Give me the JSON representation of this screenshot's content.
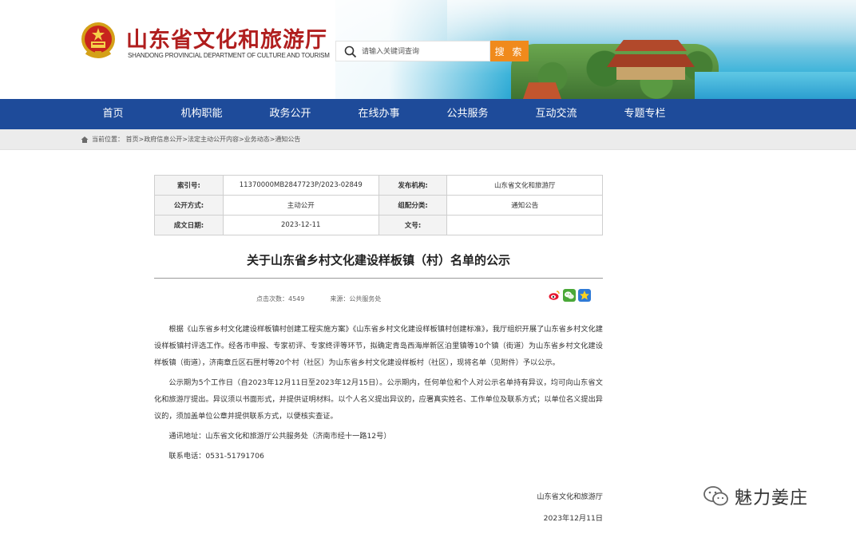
{
  "header": {
    "site_name": "山东省文化和旅游厅",
    "site_name_en": "SHANDONG PROVINCIAL DEPARTMENT OF CULTURE AND TOURISM",
    "search_placeholder": "请输入关键词查询",
    "search_button": "搜 索"
  },
  "nav": {
    "items": [
      "首页",
      "机构职能",
      "政务公开",
      "在线办事",
      "公共服务",
      "互动交流",
      "专题专栏"
    ]
  },
  "breadcrumb": {
    "label": "当前位置：",
    "path": "首页>政府信息公开>法定主动公开内容>业务动态>通知公告"
  },
  "meta": {
    "index_key": "索引号:",
    "index_value": "11370000MB2847723P/2023-02849",
    "publisher_key": "发布机构:",
    "publisher_value": "山东省文化和旅游厅",
    "mode_key": "公开方式:",
    "mode_value": "主动公开",
    "category_key": "组配分类:",
    "category_value": "通知公告",
    "date_key": "成文日期:",
    "date_value": "2023-12-11",
    "doc_no_key": "文号:",
    "doc_no_value": ""
  },
  "article": {
    "title": "关于山东省乡村文化建设样板镇（村）名单的公示",
    "views_label": "点击次数：",
    "views_value": "4549",
    "source_label": "来源：",
    "source_value": "公共服务处",
    "p1": "根据《山东省乡村文化建设样板镇村创建工程实施方案》《山东省乡村文化建设样板镇村创建标准》，我厅组织开展了山东省乡村文化建设样板镇村评选工作。经各市申报、专家初评、专家终评等环节，拟确定青岛西海岸新区泊里镇等10个镇（街道）为山东省乡村文化建设样板镇（街道），济南章丘区石匣村等20个村（社区）为山东省乡村文化建设样板村（社区），现将名单（见附件）予以公示。",
    "p2": "公示期为5个工作日（自2023年12月11日至2023年12月15日）。公示期内，任何单位和个人对公示名单持有异议，均可向山东省文化和旅游厅提出。异议须以书面形式，并提供证明材料。以个人名义提出异议的，应署真实姓名、工作单位及联系方式；以单位名义提出异议的，须加盖单位公章并提供联系方式，以便核实查证。",
    "p3": "通讯地址：山东省文化和旅游厅公共服务处（济南市经十一路12号）",
    "p4": "联系电话：0531-51791706",
    "signature": "山东省文化和旅游厅",
    "sign_date": "2023年12月11日"
  },
  "watermark": "魅力姜庄",
  "colors": {
    "nav_bg": "#1e4b9a",
    "logo_red": "#b01e1e",
    "search_orange": "#f08a1c"
  }
}
